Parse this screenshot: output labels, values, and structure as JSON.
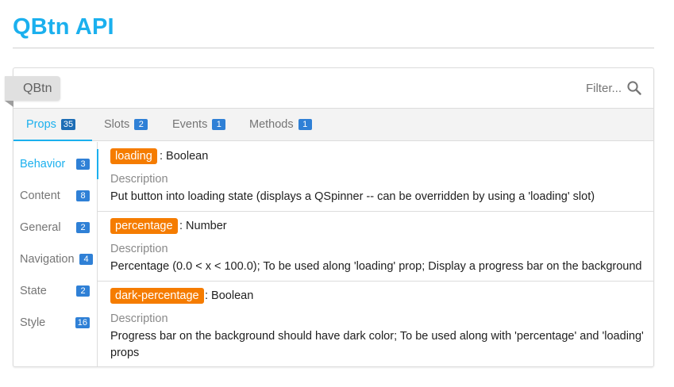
{
  "page": {
    "title": "QBtn API"
  },
  "header": {
    "component_label": "QBtn",
    "filter_placeholder": "Filter..."
  },
  "tabs": [
    {
      "label": "Props",
      "count": "35",
      "active": true
    },
    {
      "label": "Slots",
      "count": "2",
      "active": false
    },
    {
      "label": "Events",
      "count": "1",
      "active": false
    },
    {
      "label": "Methods",
      "count": "1",
      "active": false
    }
  ],
  "sidebar": {
    "items": [
      {
        "label": "Behavior",
        "count": "3",
        "active": true
      },
      {
        "label": "Content",
        "count": "8",
        "active": false
      },
      {
        "label": "General",
        "count": "2",
        "active": false
      },
      {
        "label": "Navigation",
        "count": "4",
        "active": false
      },
      {
        "label": "State",
        "count": "2",
        "active": false
      },
      {
        "label": "Style",
        "count": "16",
        "active": false
      }
    ]
  },
  "props": [
    {
      "name": "loading",
      "type": ": Boolean",
      "desc_label": "Description",
      "description": "Put button into loading state (displays a QSpinner -- can be overridden by using a 'loading' slot)"
    },
    {
      "name": "percentage",
      "type": ": Number",
      "desc_label": "Description",
      "description": "Percentage (0.0 < x < 100.0); To be used along 'loading' prop; Display a progress bar on the background"
    },
    {
      "name": "dark-percentage",
      "type": ": Boolean",
      "desc_label": "Description",
      "description": "Progress bar on the background should have dark color; To be used along with 'percentage' and 'loading' props"
    }
  ],
  "colors": {
    "accent": "#1bb0ee",
    "badge": "#2f80d6",
    "prop_name": "#f57c00"
  },
  "icons": {
    "filter": "search-icon"
  }
}
